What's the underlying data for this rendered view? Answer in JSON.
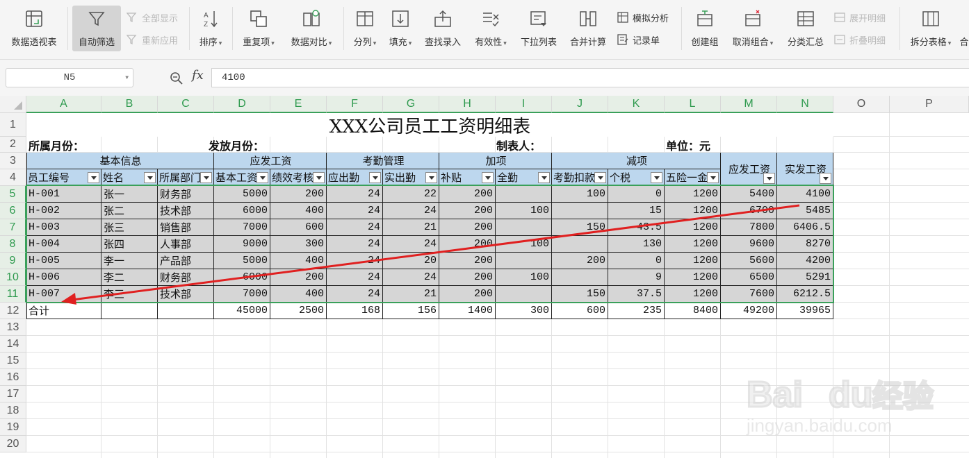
{
  "ribbon": {
    "pivot": "数据透视表",
    "autofilter": "自动筛选",
    "show_all": "全部显示",
    "reapply": "重新应用",
    "sort": "排序",
    "duplicates": "重复项",
    "compare": "数据对比",
    "split_col": "分列",
    "fill": "填充",
    "lookup": "查找录入",
    "validity": "有效性",
    "dropdown_list": "下拉列表",
    "consolidate": "合并计算",
    "simulate": "模拟分析",
    "record": "记录单",
    "group": "创建组",
    "ungroup": "取消组合",
    "subtotal": "分类汇总",
    "expand": "展开明细",
    "collapse": "折叠明细",
    "split_table": "拆分表格",
    "more": "合"
  },
  "formula_bar": {
    "cell_ref": "N5",
    "fx": "fx",
    "value": "4100"
  },
  "columns": [
    "A",
    "B",
    "C",
    "D",
    "E",
    "F",
    "G",
    "H",
    "I",
    "J",
    "K",
    "L",
    "M",
    "N",
    "O",
    "P"
  ],
  "rows": [
    "1",
    "2",
    "3",
    "4",
    "5",
    "6",
    "7",
    "8",
    "9",
    "10",
    "11",
    "12",
    "13",
    "14",
    "15",
    "16",
    "17",
    "18",
    "19",
    "20"
  ],
  "sheet": {
    "title": "XXX公司员工工资明细表",
    "month_label": "所属月份：",
    "pay_month_label": "发放月份：",
    "maker_label": "制表人：",
    "unit_label": "单位：元",
    "groups": {
      "basic": "基本信息",
      "payable": "应发工资",
      "attendance": "考勤管理",
      "plus": "加项",
      "minus": "减项",
      "gross": "应发工资",
      "net": "实发工资"
    },
    "headers": [
      "员工编号",
      "姓名",
      "所属部门",
      "基本工资",
      "绩效考核",
      "应出勤",
      "实出勤",
      "补贴",
      "全勤",
      "考勤扣款",
      "个税",
      "五险一金"
    ],
    "data": [
      [
        "H-001",
        "张一",
        "财务部",
        "5000",
        "200",
        "24",
        "22",
        "200",
        "",
        "100",
        "0",
        "1200",
        "5400",
        "4100"
      ],
      [
        "H-002",
        "张二",
        "技术部",
        "6000",
        "400",
        "24",
        "24",
        "200",
        "100",
        "",
        "15",
        "1200",
        "6700",
        "5485"
      ],
      [
        "H-003",
        "张三",
        "销售部",
        "7000",
        "600",
        "24",
        "21",
        "200",
        "",
        "150",
        "43.5",
        "1200",
        "7800",
        "6406.5"
      ],
      [
        "H-004",
        "张四",
        "人事部",
        "9000",
        "300",
        "24",
        "24",
        "200",
        "100",
        "",
        "130",
        "1200",
        "9600",
        "8270"
      ],
      [
        "H-005",
        "李一",
        "产品部",
        "5000",
        "400",
        "24",
        "20",
        "200",
        "",
        "200",
        "0",
        "1200",
        "5600",
        "4200"
      ],
      [
        "H-006",
        "李二",
        "财务部",
        "6000",
        "200",
        "24",
        "24",
        "200",
        "100",
        "",
        "9",
        "1200",
        "6500",
        "5291"
      ],
      [
        "H-007",
        "李三",
        "技术部",
        "7000",
        "400",
        "24",
        "21",
        "200",
        "",
        "150",
        "37.5",
        "1200",
        "7600",
        "6212.5"
      ]
    ],
    "total": [
      "合计",
      "",
      "",
      "45000",
      "2500",
      "168",
      "156",
      "1400",
      "300",
      "600",
      "235",
      "8400",
      "49200",
      "39965"
    ]
  },
  "watermark": {
    "brand": "Bai",
    "brand2": "du",
    "cn": "经验",
    "url": "jingyan.baidu.com"
  },
  "colors": {
    "selection": "#3aa05a",
    "header_fill": "#bdd7ee",
    "row_fill": "#d6d6d6",
    "arrow": "#e02020"
  }
}
